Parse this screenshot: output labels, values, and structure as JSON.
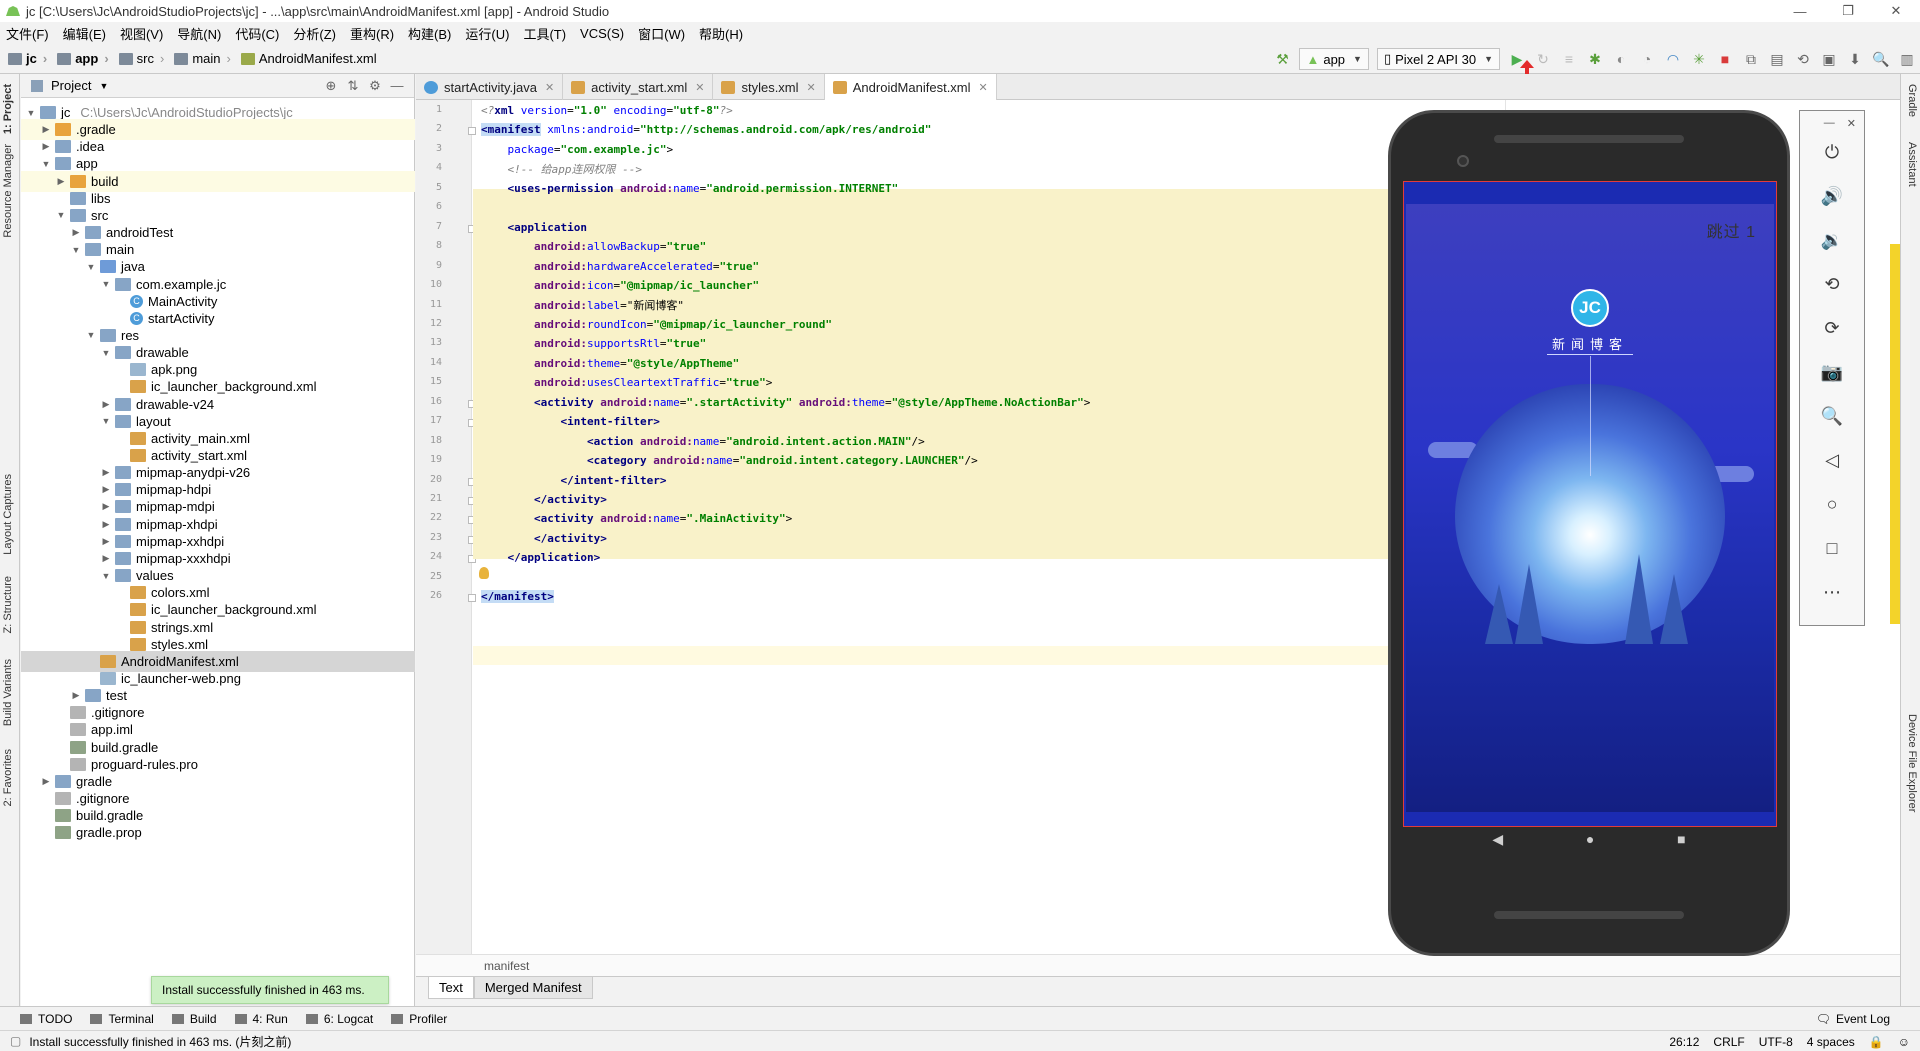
{
  "window": {
    "title": "jc [C:\\Users\\Jc\\AndroidStudioProjects\\jc] - ...\\app\\src\\main\\AndroidManifest.xml [app] - Android Studio"
  },
  "menu": [
    "文件(F)",
    "编辑(E)",
    "视图(V)",
    "导航(N)",
    "代码(C)",
    "分析(Z)",
    "重构(R)",
    "构建(B)",
    "运行(U)",
    "工具(T)",
    "VCS(S)",
    "窗口(W)",
    "帮助(H)"
  ],
  "breadcrumbs": [
    "jc",
    "app",
    "src",
    "main",
    "AndroidManifest.xml"
  ],
  "toolbar": {
    "run_config": "app",
    "device": "Pixel 2 API 30"
  },
  "project_panel": {
    "title": "Project",
    "tree": [
      {
        "label": "jc",
        "sub": "C:\\Users\\Jc\\AndroidStudioProjects\\jc",
        "depth": 0,
        "icon": "folder",
        "open": true
      },
      {
        "label": ".gradle",
        "depth": 1,
        "icon": "folder-orange",
        "open": false,
        "hl": true
      },
      {
        "label": ".idea",
        "depth": 1,
        "icon": "folder",
        "open": false
      },
      {
        "label": "app",
        "depth": 1,
        "icon": "folder",
        "open": true
      },
      {
        "label": "build",
        "depth": 2,
        "icon": "folder-orange",
        "open": false,
        "hl": true
      },
      {
        "label": "libs",
        "depth": 2,
        "icon": "folder",
        "leaf": true
      },
      {
        "label": "src",
        "depth": 2,
        "icon": "folder",
        "open": true
      },
      {
        "label": "androidTest",
        "depth": 3,
        "icon": "folder",
        "open": false
      },
      {
        "label": "main",
        "depth": 3,
        "icon": "folder",
        "open": true
      },
      {
        "label": "java",
        "depth": 4,
        "icon": "folder-blue",
        "open": true
      },
      {
        "label": "com.example.jc",
        "depth": 5,
        "icon": "folder",
        "open": true
      },
      {
        "label": "MainActivity",
        "depth": 6,
        "icon": "class",
        "leaf": true
      },
      {
        "label": "startActivity",
        "depth": 6,
        "icon": "class",
        "leaf": true
      },
      {
        "label": "res",
        "depth": 4,
        "icon": "folder",
        "open": true
      },
      {
        "label": "drawable",
        "depth": 5,
        "icon": "folder",
        "open": true
      },
      {
        "label": "apk.png",
        "depth": 6,
        "icon": "img",
        "leaf": true
      },
      {
        "label": "ic_launcher_background.xml",
        "depth": 6,
        "icon": "xml",
        "leaf": true
      },
      {
        "label": "drawable-v24",
        "depth": 5,
        "icon": "folder",
        "open": false
      },
      {
        "label": "layout",
        "depth": 5,
        "icon": "folder",
        "open": true
      },
      {
        "label": "activity_main.xml",
        "depth": 6,
        "icon": "xml",
        "leaf": true
      },
      {
        "label": "activity_start.xml",
        "depth": 6,
        "icon": "xml",
        "leaf": true
      },
      {
        "label": "mipmap-anydpi-v26",
        "depth": 5,
        "icon": "folder",
        "open": false
      },
      {
        "label": "mipmap-hdpi",
        "depth": 5,
        "icon": "folder",
        "open": false
      },
      {
        "label": "mipmap-mdpi",
        "depth": 5,
        "icon": "folder",
        "open": false
      },
      {
        "label": "mipmap-xhdpi",
        "depth": 5,
        "icon": "folder",
        "open": false
      },
      {
        "label": "mipmap-xxhdpi",
        "depth": 5,
        "icon": "folder",
        "open": false
      },
      {
        "label": "mipmap-xxxhdpi",
        "depth": 5,
        "icon": "folder",
        "open": false
      },
      {
        "label": "values",
        "depth": 5,
        "icon": "folder",
        "open": true
      },
      {
        "label": "colors.xml",
        "depth": 6,
        "icon": "xml",
        "leaf": true
      },
      {
        "label": "ic_launcher_background.xml",
        "depth": 6,
        "icon": "xml",
        "leaf": true
      },
      {
        "label": "strings.xml",
        "depth": 6,
        "icon": "xml",
        "leaf": true
      },
      {
        "label": "styles.xml",
        "depth": 6,
        "icon": "xml",
        "leaf": true
      },
      {
        "label": "AndroidManifest.xml",
        "depth": 4,
        "icon": "xml",
        "leaf": true,
        "sel": true
      },
      {
        "label": "ic_launcher-web.png",
        "depth": 4,
        "icon": "img",
        "leaf": true
      },
      {
        "label": "test",
        "depth": 3,
        "icon": "folder",
        "open": false
      },
      {
        "label": ".gitignore",
        "depth": 2,
        "icon": "txt",
        "leaf": true
      },
      {
        "label": "app.iml",
        "depth": 2,
        "icon": "txt",
        "leaf": true
      },
      {
        "label": "build.gradle",
        "depth": 2,
        "icon": "gradle",
        "leaf": true
      },
      {
        "label": "proguard-rules.pro",
        "depth": 2,
        "icon": "txt",
        "leaf": true
      },
      {
        "label": "gradle",
        "depth": 1,
        "icon": "folder",
        "open": false
      },
      {
        "label": ".gitignore",
        "depth": 1,
        "icon": "txt",
        "leaf": true
      },
      {
        "label": "build.gradle",
        "depth": 1,
        "icon": "gradle",
        "leaf": true
      },
      {
        "label": "gradle.prop",
        "depth": 1,
        "icon": "gradle",
        "leaf": true
      }
    ]
  },
  "editor": {
    "tabs": [
      {
        "label": "startActivity.java",
        "icon": "java"
      },
      {
        "label": "activity_start.xml",
        "icon": "xml"
      },
      {
        "label": "styles.xml",
        "icon": "xml"
      },
      {
        "label": "AndroidManifest.xml",
        "icon": "xml",
        "active": true
      }
    ],
    "lines": [
      [
        [
          "c-com",
          "<?"
        ],
        [
          "c-tag",
          "xml "
        ],
        [
          "c-attr",
          "version"
        ],
        [
          "",
          "="
        ],
        [
          "c-val",
          "\"1.0\" "
        ],
        [
          "c-attr",
          "encoding"
        ],
        [
          "",
          "="
        ],
        [
          "c-val",
          "\"utf-8\""
        ],
        [
          "c-com",
          "?>"
        ]
      ],
      [
        [
          "hl-tag c-tag",
          "<manifest"
        ],
        [
          "",
          " "
        ],
        [
          "c-attr",
          "xmlns:android"
        ],
        [
          "",
          "="
        ],
        [
          "c-val",
          "\"http://schemas.android.com/apk/res/android\""
        ]
      ],
      [
        [
          "",
          "    "
        ],
        [
          "c-attr",
          "package"
        ],
        [
          "",
          "="
        ],
        [
          "c-val",
          "\"com.example.jc\""
        ],
        [
          "",
          ">"
        ]
      ],
      [
        [
          "",
          "    "
        ],
        [
          "c-com",
          "<!-- 给app连网权限 -->"
        ]
      ],
      [
        [
          "",
          "    "
        ],
        [
          "c-tag",
          "<uses-permission "
        ],
        [
          "c-ns",
          "android:"
        ],
        [
          "c-attr",
          "name"
        ],
        [
          "",
          "="
        ],
        [
          "c-val",
          "\"android.permission.INTERNET\""
        ],
        [
          "",
          "",
          " />"
        ]
      ],
      [],
      [
        [
          "",
          "    "
        ],
        [
          "c-tag",
          "<application"
        ]
      ],
      [
        [
          "",
          "        "
        ],
        [
          "c-ns",
          "android:"
        ],
        [
          "c-attr",
          "allowBackup"
        ],
        [
          "",
          "="
        ],
        [
          "c-val",
          "\"true\""
        ]
      ],
      [
        [
          "",
          "        "
        ],
        [
          "c-ns",
          "android:"
        ],
        [
          "c-attr",
          "hardwareAccelerated"
        ],
        [
          "",
          "="
        ],
        [
          "c-val",
          "\"true\""
        ]
      ],
      [
        [
          "",
          "        "
        ],
        [
          "c-ns",
          "android:"
        ],
        [
          "c-attr",
          "icon"
        ],
        [
          "",
          "="
        ],
        [
          "c-val",
          "\"@mipmap/ic_launcher\""
        ]
      ],
      [
        [
          "",
          "        "
        ],
        [
          "c-ns",
          "android:"
        ],
        [
          "c-attr",
          "label"
        ],
        [
          "",
          "="
        ],
        [
          "",
          "\"新闻博客\""
        ]
      ],
      [
        [
          "",
          "        "
        ],
        [
          "c-ns",
          "android:"
        ],
        [
          "c-attr",
          "roundIcon"
        ],
        [
          "",
          "="
        ],
        [
          "c-val",
          "\"@mipmap/ic_launcher_round\""
        ]
      ],
      [
        [
          "",
          "        "
        ],
        [
          "c-ns",
          "android:"
        ],
        [
          "c-attr",
          "supportsRtl"
        ],
        [
          "",
          "="
        ],
        [
          "c-val",
          "\"true\""
        ]
      ],
      [
        [
          "",
          "        "
        ],
        [
          "c-ns",
          "android:"
        ],
        [
          "c-attr",
          "theme"
        ],
        [
          "",
          "="
        ],
        [
          "c-val",
          "\"@style/AppTheme\""
        ]
      ],
      [
        [
          "",
          "        "
        ],
        [
          "c-ns",
          "android:"
        ],
        [
          "c-attr",
          "usesCleartextTraffic"
        ],
        [
          "",
          "="
        ],
        [
          "c-val",
          "\"true\""
        ],
        [
          "",
          ">"
        ]
      ],
      [
        [
          "",
          "        "
        ],
        [
          "c-tag",
          "<activity "
        ],
        [
          "c-ns",
          "android:"
        ],
        [
          "c-attr",
          "name"
        ],
        [
          "",
          "="
        ],
        [
          "c-val",
          "\".startActivity\" "
        ],
        [
          "c-ns",
          "android:"
        ],
        [
          "c-attr",
          "theme"
        ],
        [
          "",
          "="
        ],
        [
          "c-val",
          "\"@style/AppTheme.NoActionBar\""
        ],
        [
          "",
          ">"
        ]
      ],
      [
        [
          "",
          "            "
        ],
        [
          "c-tag",
          "<intent-filter>"
        ]
      ],
      [
        [
          "",
          "                "
        ],
        [
          "c-tag",
          "<action "
        ],
        [
          "c-ns",
          "android:"
        ],
        [
          "c-attr",
          "name"
        ],
        [
          "",
          "="
        ],
        [
          "c-val",
          "\"android.intent.action.MAIN\""
        ],
        [
          "",
          "/>"
        ]
      ],
      [
        [
          "",
          "                "
        ],
        [
          "c-tag",
          "<category "
        ],
        [
          "c-ns",
          "android:"
        ],
        [
          "c-attr",
          "name"
        ],
        [
          "",
          "="
        ],
        [
          "c-val",
          "\"android.intent.category.LAUNCHER\""
        ],
        [
          "",
          "/>"
        ]
      ],
      [
        [
          "",
          "            "
        ],
        [
          "c-tag",
          "</intent-filter>"
        ]
      ],
      [
        [
          "",
          "        "
        ],
        [
          "c-tag",
          "</activity>"
        ]
      ],
      [
        [
          "",
          "        "
        ],
        [
          "c-tag",
          "<activity "
        ],
        [
          "c-ns",
          "android:"
        ],
        [
          "c-attr",
          "name"
        ],
        [
          "",
          "="
        ],
        [
          "c-val",
          "\".MainActivity\""
        ],
        [
          "",
          ">"
        ]
      ],
      [
        [
          "",
          "        "
        ],
        [
          "c-tag",
          "</activity>"
        ]
      ],
      [
        [
          "",
          "    "
        ],
        [
          "c-tag",
          "</application>"
        ]
      ],
      [],
      [
        [
          "hl-tag c-tag",
          "</manifest>"
        ]
      ]
    ],
    "breadcrumb": "manifest",
    "bottom_tabs": [
      "Text",
      "Merged Manifest"
    ]
  },
  "left_strip": [
    "1: Project",
    "Resource Manager",
    "Layout Captures",
    "Z: Structure",
    "Build Variants",
    "2: Favorites"
  ],
  "right_strip": [
    "Gradle",
    "Assistant",
    "Device File Explorer"
  ],
  "tool_windows": [
    "TODO",
    "Terminal",
    "Build",
    "4: Run",
    "6: Logcat",
    "Profiler"
  ],
  "event_log": "Event Log",
  "status": {
    "message": "Install successfully finished in 463 ms. (片刻之前)",
    "position": "26:12",
    "line_sep": "CRLF",
    "encoding": "UTF-8",
    "indent": "4 spaces"
  },
  "toast": "Install successfully finished in 463 ms.",
  "emulator": {
    "skip": "跳过 1",
    "logo": "JC",
    "brand": "新闻博客",
    "controls": [
      "power-icon",
      "volume-up-icon",
      "volume-down-icon",
      "rotate-left-icon",
      "rotate-right-icon",
      "camera-icon",
      "zoom-icon",
      "back-icon",
      "home-icon",
      "overview-icon",
      "more-icon"
    ],
    "control_glyphs": [
      "⏻",
      "🔊",
      "🔉",
      "⟲",
      "⟳",
      "📷",
      "🔍",
      "◁",
      "○",
      "□",
      "⋯"
    ],
    "nav": [
      "◀",
      "●",
      "■"
    ]
  }
}
